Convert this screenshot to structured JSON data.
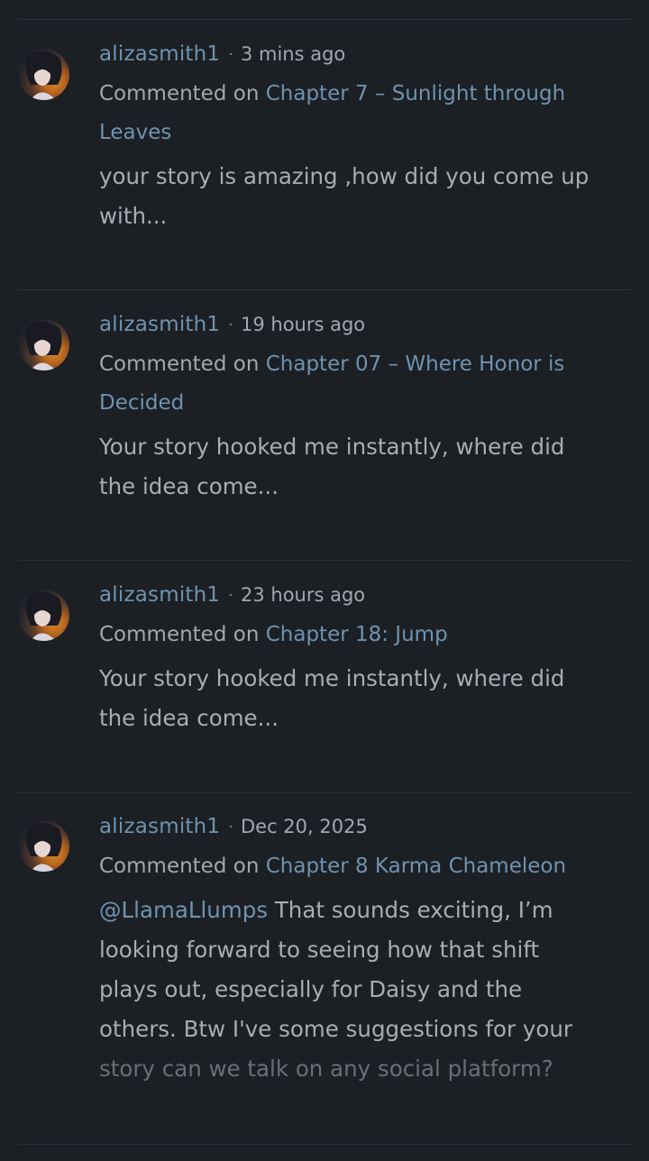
{
  "comments": [
    {
      "username": "alizasmith1",
      "time": "3 mins ago",
      "commented_on_label": "Commented on",
      "chapter": "Chapter 7 – Sunlight through Leaves",
      "text": "your story is amazing ,how did you come up with..."
    },
    {
      "username": "alizasmith1",
      "time": "19 hours ago",
      "commented_on_label": "Commented on",
      "chapter": "Chapter 07 – Where Honor is Decided",
      "text": "Your story hooked me instantly, where did the idea come..."
    },
    {
      "username": "alizasmith1",
      "time": "23 hours ago",
      "commented_on_label": "Commented on",
      "chapter": "Chapter 18: Jump",
      "text": "Your story hooked me instantly, where did the idea come..."
    },
    {
      "username": "alizasmith1",
      "time": "Dec 20, 2025",
      "commented_on_label": "Commented on",
      "chapter": "Chapter 8 Karma Chameleon",
      "mention": "@LlamaLlumps",
      "text": " That sounds exciting, I’m looking forward to seeing how that shift plays out, especially for Daisy and the others. Btw I've some suggestions for your ",
      "text_faded": "story can we talk on any social platform?"
    }
  ],
  "separator_dot": "·",
  "icons": {
    "avatar": "user-avatar-anime-portrait"
  },
  "colors": {
    "background": "#1c1f23",
    "link": "#6e93b1",
    "text": "#a9adb2",
    "divider": "#2c3036"
  }
}
